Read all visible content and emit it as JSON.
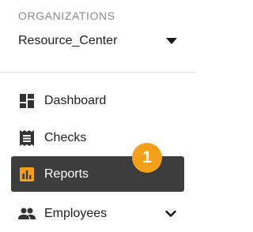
{
  "organizations": {
    "heading": "ORGANIZATIONS",
    "selected": "Resource_Center",
    "dropdown_icon": "caret-down-icon"
  },
  "nav": {
    "items": [
      {
        "label": "Dashboard",
        "icon": "dashboard-icon",
        "active": false
      },
      {
        "label": "Checks",
        "icon": "receipt-icon",
        "active": false
      },
      {
        "label": "Reports",
        "icon": "bar-chart-icon",
        "active": true
      },
      {
        "label": "Employees",
        "icon": "people-icon",
        "active": false,
        "expandable": true
      }
    ]
  },
  "annotation": {
    "badge": "1"
  },
  "colors": {
    "active_background": "#3d3d3d",
    "reports_icon": "#f5a01a",
    "badge": "#f5a01a"
  }
}
